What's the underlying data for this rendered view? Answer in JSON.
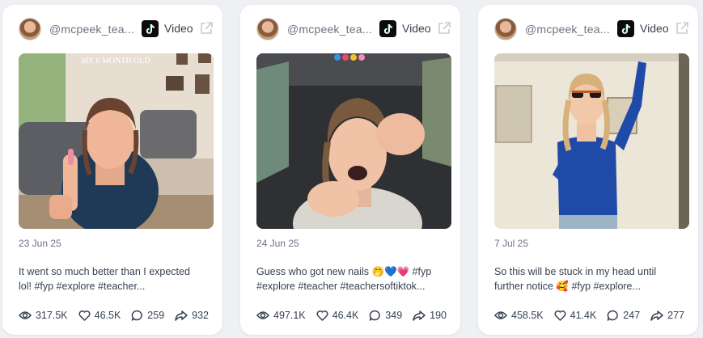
{
  "cards": [
    {
      "handle": "@mcpeek_tea...",
      "type": "Video",
      "media_overlay": "MY 6 MONTH OLD",
      "date": "23 Jun 25",
      "caption_line1": "It went so much better than I expected",
      "caption_line2": "lol! #fyp #explore #teacher...",
      "views": "317.5K",
      "likes": "46.5K",
      "comments": "259",
      "shares": "932"
    },
    {
      "handle": "@mcpeek_tea...",
      "type": "Video",
      "date": "24 Jun 25",
      "caption_line1": "Guess who got new nails 🤭💙💗 #fyp",
      "caption_line2": "#explore #teacher #teachersoftiktok...",
      "views": "497.1K",
      "likes": "46.4K",
      "comments": "349",
      "shares": "190"
    },
    {
      "handle": "@mcpeek_tea...",
      "type": "Video",
      "date": "7 Jul 25",
      "caption_line1": "So this will be stuck in my head until",
      "caption_line2": "further notice 🥰 #fyp #explore...",
      "views": "458.5K",
      "likes": "41.4K",
      "comments": "247",
      "shares": "277"
    }
  ],
  "colors": {
    "page_bg": "#eef0f4",
    "card_bg": "#ffffff",
    "muted_text": "#6b7280",
    "body_text": "#374151",
    "tiktok_black": "#0b0b0b"
  },
  "icons": [
    "tiktok-icon",
    "external-link-icon",
    "eye-icon",
    "heart-icon",
    "comment-icon",
    "share-icon"
  ]
}
